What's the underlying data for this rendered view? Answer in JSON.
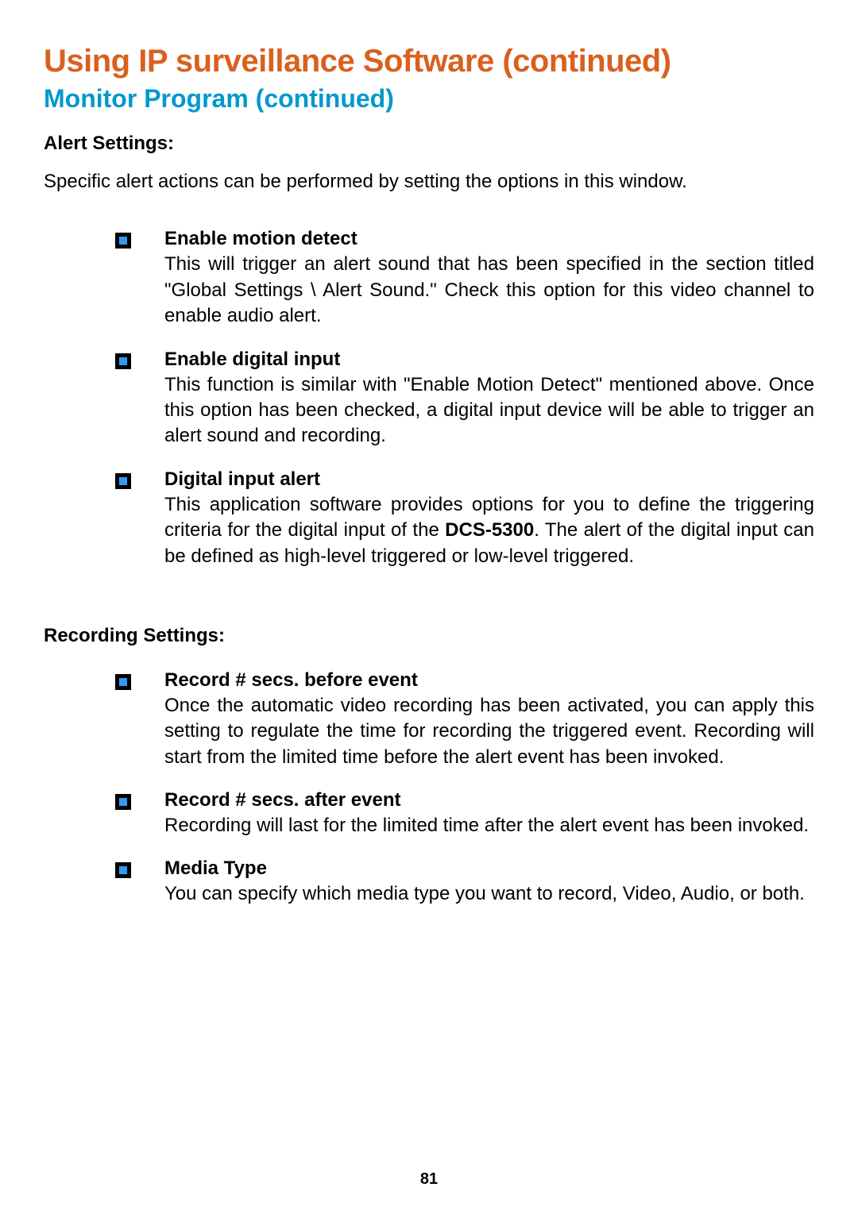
{
  "title": "Using IP surveillance Software (continued)",
  "subtitle": "Monitor Program (continued)",
  "alert_section": {
    "heading": "Alert Settings:",
    "intro": "Specific alert actions can be performed by setting the options in this window.",
    "items": {
      "motion": {
        "title": "Enable motion detect",
        "body": "This will trigger an alert sound that has been specified in the section titled \"Global Settings \\ Alert Sound.\" Check this option for this video channel to enable audio alert."
      },
      "digital_input": {
        "title": "Enable digital input",
        "body": "This function is similar with \"Enable Motion Detect\" mentioned above. Once this option has been checked, a digital input device will be able to trigger an alert sound and recording."
      },
      "digital_alert": {
        "title": "Digital input alert",
        "body_pre": "This application software provides options for you to define the triggering criteria for the digital input of the ",
        "body_bold": "DCS-5300",
        "body_post": ". The alert of the digital input can be defined as high-level triggered or low-level triggered."
      }
    }
  },
  "recording_section": {
    "heading": "Recording Settings:",
    "items": {
      "before": {
        "title": "Record # secs. before event",
        "body": "Once the automatic video recording has been activated, you can apply this setting to regulate the time for recording the triggered event. Recording will start from the limited time before the alert event has been invoked."
      },
      "after": {
        "title": "Record # secs. after event",
        "body": "Recording will last for the limited time after the alert event has been invoked."
      },
      "media": {
        "title": "Media Type",
        "body": "You can specify which media type you want to record, Video, Audio, or both."
      }
    }
  },
  "page_number": "81"
}
